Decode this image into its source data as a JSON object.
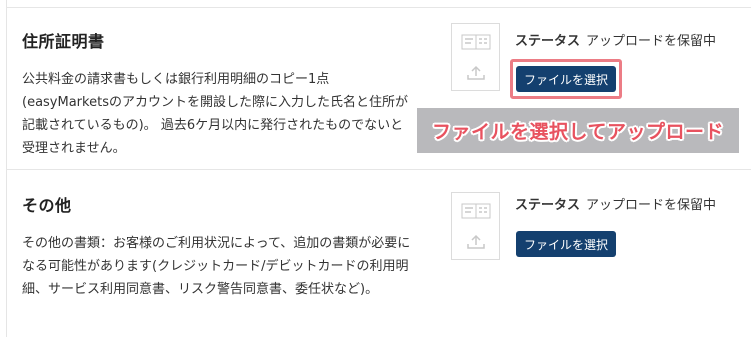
{
  "sections": [
    {
      "title": "住所証明書",
      "description": "公共料金の請求書もしくは銀行利用明細のコピー1点(easyMarketsのアカウントを開設した際に入力した氏名と住所が記載されているもの)。 過去6ケ月以内に発行されたものでないと受理されません。",
      "status_label": "ステータス",
      "status_value": "アップロードを保留中",
      "button_label": "ファイルを選択",
      "thumbnail_icon": "document-upload-icon"
    },
    {
      "title": "その他",
      "description": "その他の書類：お客様のご利用状況によって、追加の書類が必要になる可能性があります(クレジットカード/デビットカードの利用明細、サービス利用同意書、リスク警告同意書、委任状など)。",
      "status_label": "ステータス",
      "status_value": "アップロードを保留中",
      "button_label": "ファイルを選択",
      "thumbnail_icon": "document-upload-icon"
    }
  ],
  "annotation": {
    "text": "ファイルを選択してアップロード",
    "text_color": "#e8525f",
    "highlight_color": "#ec7c85"
  },
  "colors": {
    "button_bg": "#14406f",
    "button_text": "#ffffff"
  }
}
